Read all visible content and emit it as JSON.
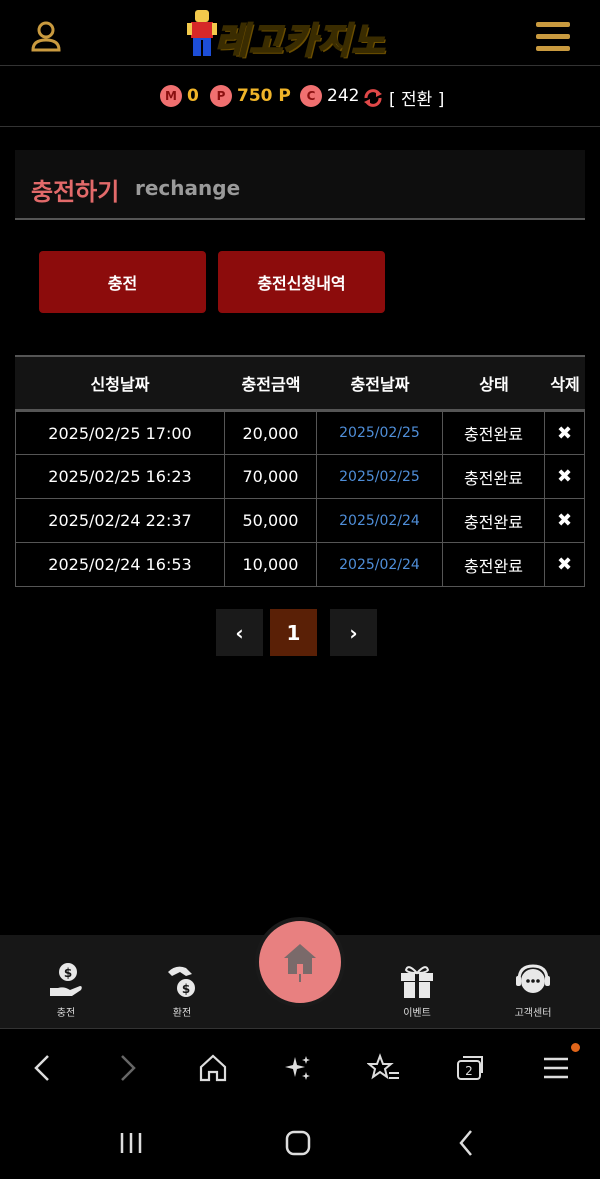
{
  "header": {
    "logo_text": "레고카지노",
    "user_icon": "user-icon",
    "menu_icon": "hamburger-menu-icon"
  },
  "points": {
    "m_badge": "M",
    "m_value": "0",
    "p_badge": "P",
    "p_value": "750 P",
    "c_badge": "C",
    "c_value": "242",
    "switch_label": "[ 전환 ]"
  },
  "page": {
    "title_ko": "충전하기",
    "title_en": "rechange"
  },
  "buttons": {
    "charge": "충전",
    "history": "충전신청내역"
  },
  "table": {
    "headers": [
      "신청날짜",
      "충전금액",
      "충전날짜",
      "상태",
      "삭제"
    ],
    "rows": [
      [
        "2025/02/25 17:00",
        "20,000",
        "2025/02/25",
        "충전완료",
        "✖"
      ],
      [
        "2025/02/25 16:23",
        "70,000",
        "2025/02/25",
        "충전완료",
        "✖"
      ],
      [
        "2025/02/24 22:37",
        "50,000",
        "2025/02/24",
        "충전완료",
        "✖"
      ],
      [
        "2025/02/24 16:53",
        "10,000",
        "2025/02/24",
        "충전완료",
        "✖"
      ]
    ]
  },
  "pagination": {
    "prev": "‹",
    "current": "1",
    "next": "›"
  },
  "bottom_nav": {
    "charge": "충전",
    "exchange": "환전",
    "event": "이벤트",
    "support": "고객센터"
  },
  "colors": {
    "accent_red": "#8c0c0c",
    "title_red": "#e26a6a",
    "gold": "#f0b429",
    "link_blue": "#4f8ed8",
    "page_active": "#5a2006"
  }
}
